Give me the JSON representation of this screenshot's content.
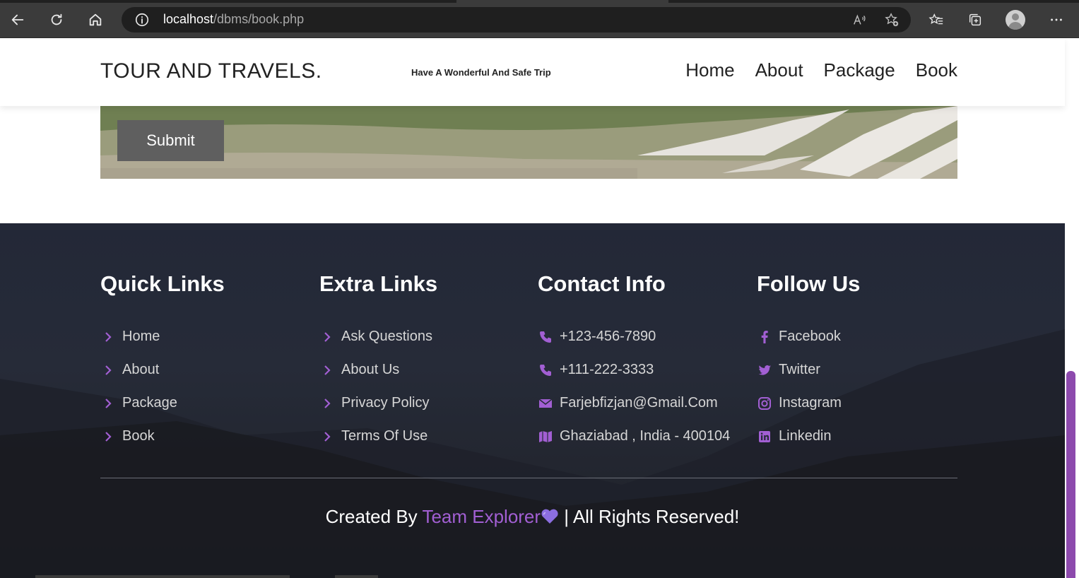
{
  "browser": {
    "url_host": "localhost",
    "url_path": "/dbms/book.php",
    "icons": [
      "back-icon",
      "refresh-icon",
      "home-icon",
      "info-icon",
      "read-aloud-icon",
      "add-favorite-icon",
      "favorites-icon",
      "collections-icon",
      "profile-icon",
      "more-icon"
    ]
  },
  "header": {
    "logo": "TOUR AND TRAVELS.",
    "tagline": "Have A Wonderful And Safe Trip",
    "nav": [
      "Home",
      "About",
      "Package",
      "Book"
    ]
  },
  "form": {
    "submit_label": "Submit"
  },
  "footer": {
    "quick_links": {
      "title": "Quick Links",
      "items": [
        "Home",
        "About",
        "Package",
        "Book"
      ]
    },
    "extra_links": {
      "title": "Extra Links",
      "items": [
        "Ask Questions",
        "About Us",
        "Privacy Policy",
        "Terms Of Use"
      ]
    },
    "contact_info": {
      "title": "Contact Info",
      "items": [
        {
          "icon": "phone-icon",
          "text": "+123-456-7890"
        },
        {
          "icon": "phone-icon",
          "text": "+111-222-3333"
        },
        {
          "icon": "envelope-icon",
          "text": "Farjebfizjan@Gmail.Com"
        },
        {
          "icon": "map-icon",
          "text": "Ghaziabad , India - 400104"
        }
      ]
    },
    "follow_us": {
      "title": "Follow Us",
      "items": [
        {
          "icon": "facebook-icon",
          "text": "Facebook"
        },
        {
          "icon": "twitter-icon",
          "text": "Twitter"
        },
        {
          "icon": "instagram-icon",
          "text": "Instagram"
        },
        {
          "icon": "linkedin-icon",
          "text": "Linkedin"
        }
      ]
    },
    "credit": {
      "prefix": "Created By",
      "team": "Team Explorer",
      "suffix": "| All Rights Reserved!"
    }
  },
  "colors": {
    "accent": "#8e44ad",
    "footer_bg": "#232837",
    "submit_bg": "#5f5f5f"
  }
}
